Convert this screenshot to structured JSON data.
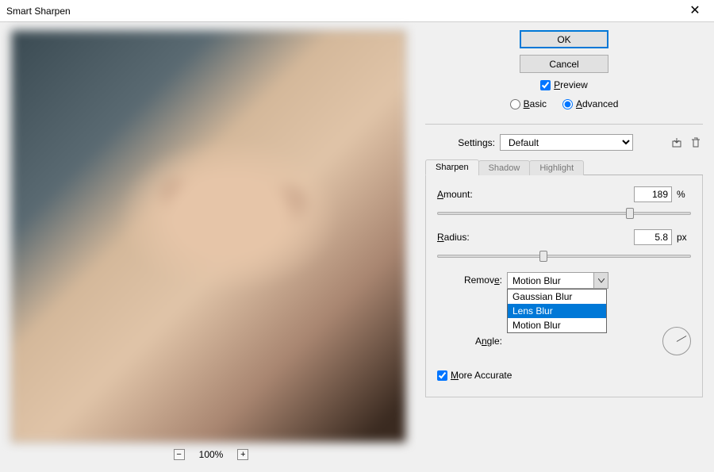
{
  "window": {
    "title": "Smart Sharpen",
    "close_glyph": "✕"
  },
  "buttons": {
    "ok": "OK",
    "cancel": "Cancel"
  },
  "preview": {
    "checked": true,
    "label_pre": "P",
    "label_rest": "review"
  },
  "mode": {
    "basic_pre": "B",
    "basic_rest": "asic",
    "advanced_pre": "A",
    "advanced_rest": "dvanced",
    "selected": "advanced"
  },
  "settings": {
    "label": "Settings:",
    "value": "Default",
    "save_tip": "save-preset-icon",
    "delete_tip": "delete-preset-icon"
  },
  "tabs": {
    "sharpen": "Sharpen",
    "shadow": "Shadow",
    "highlight": "Highlight",
    "active": "sharpen"
  },
  "amount": {
    "label_pre": "A",
    "label_rest": "mount:",
    "value": "189",
    "unit": "%",
    "pos_pct": 76
  },
  "radius": {
    "label_pre": "R",
    "label_rest": "adius:",
    "value": "5.8",
    "unit": "px",
    "pos_pct": 42
  },
  "remove": {
    "label_pre": "Remov",
    "label_underline": "e",
    "label_post": ":",
    "selected": "Motion Blur",
    "options": [
      "Gaussian Blur",
      "Lens Blur",
      "Motion Blur"
    ],
    "highlighted": "Lens Blur"
  },
  "angle": {
    "label_pre": "A",
    "label_underline": "n",
    "label_rest": "gle:"
  },
  "more_accurate": {
    "checked": true,
    "label_pre": "M",
    "label_rest": "ore Accurate"
  },
  "zoom": {
    "level": "100%",
    "minus": "−",
    "plus": "+"
  }
}
